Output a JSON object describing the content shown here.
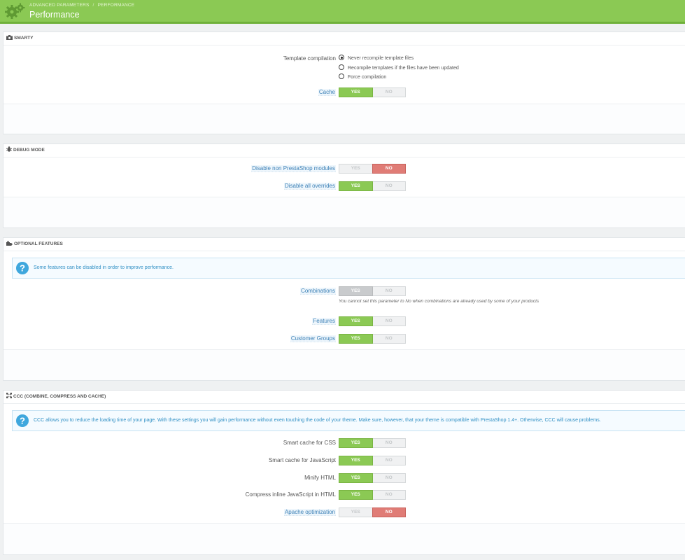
{
  "header": {
    "breadcrumb": [
      "Advanced Parameters",
      "Performance"
    ],
    "breadcrumb_separator": "/",
    "title": "Performance",
    "icon": "gears-icon"
  },
  "sections": {
    "smarty": {
      "title": "Smarty",
      "icon": "camera-icon",
      "template_compilation": {
        "label": "Template compilation",
        "options": [
          {
            "label": "Never recompile template files",
            "checked": true
          },
          {
            "label": "Recompile templates if the files have been updated",
            "checked": false
          },
          {
            "label": "Force compilation",
            "checked": false
          }
        ]
      },
      "cache": {
        "label": "Cache",
        "yes": "Yes",
        "no": "No",
        "value": "yes"
      }
    },
    "debug": {
      "title": "Debug mode",
      "icon": "bug-icon",
      "disable_non_prestashop": {
        "label": "Disable non PrestaShop modules",
        "yes": "Yes",
        "no": "No",
        "value": "no"
      },
      "disable_overrides": {
        "label": "Disable all overrides",
        "yes": "Yes",
        "no": "No",
        "value": "yes"
      }
    },
    "optional": {
      "title": "Optional features",
      "icon": "puzzle-icon",
      "alert": "Some features can be disabled in order to improve performance.",
      "combinations": {
        "label": "Combinations",
        "yes": "Yes",
        "no": "No",
        "value": "yes",
        "disabled": true
      },
      "combinations_note": "You cannot set this parameter to No when combinations are already used by some of your products",
      "features": {
        "label": "Features",
        "yes": "Yes",
        "no": "No",
        "value": "yes"
      },
      "customer_groups": {
        "label": "Customer Groups",
        "yes": "Yes",
        "no": "No",
        "value": "yes"
      }
    },
    "ccc": {
      "title": "CCC (Combine, Compress and Cache)",
      "icon": "fullscreen-icon",
      "alert": "CCC allows you to reduce the loading time of your page. With these settings you will gain performance without even touching the code of your theme. Make sure, however, that your theme is compatible with PrestaShop 1.4+. Otherwise, CCC will cause problems.",
      "smart_css": {
        "label": "Smart cache for CSS",
        "yes": "Yes",
        "no": "No",
        "value": "yes"
      },
      "smart_js": {
        "label": "Smart cache for JavaScript",
        "yes": "Yes",
        "no": "No",
        "value": "yes"
      },
      "minify_html": {
        "label": "Minify HTML",
        "yes": "Yes",
        "no": "No",
        "value": "yes"
      },
      "compress_js": {
        "label": "Compress inline JavaScript in HTML",
        "yes": "Yes",
        "no": "No",
        "value": "yes"
      },
      "apache": {
        "label": "Apache optimization",
        "yes": "Yes",
        "no": "No",
        "value": "no"
      }
    }
  },
  "colors": {
    "header_green": "#8bc954",
    "switch_yes": "#8bc954",
    "switch_no": "#e07c76",
    "switch_disabled": "#c9cbcd",
    "help_blue": "#3a7fb5",
    "alert_text": "#2f8fc4"
  }
}
